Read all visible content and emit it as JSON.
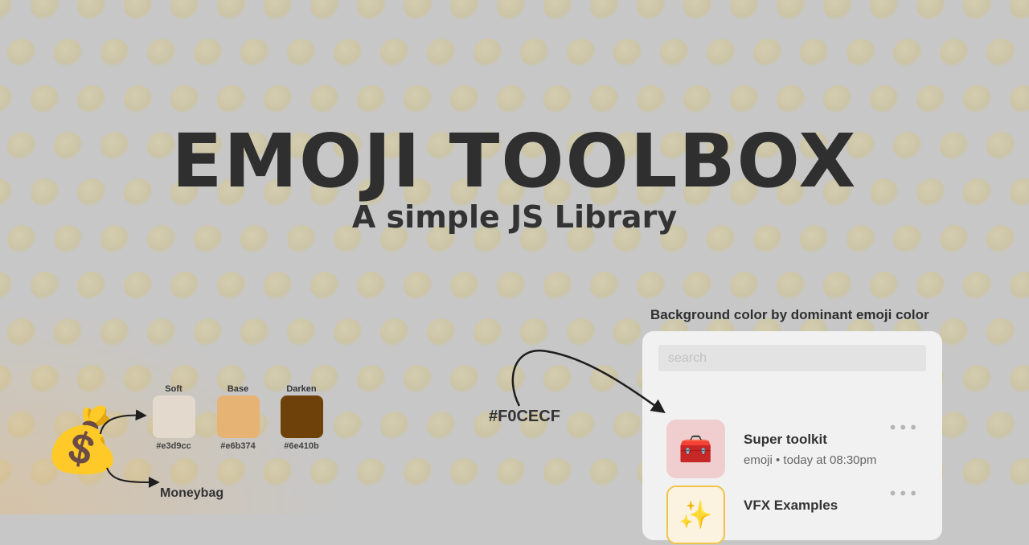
{
  "header": {
    "title": "EMOJI TOOLBOX",
    "subtitle": "A simple JS Library"
  },
  "palette": {
    "emoji": "💰",
    "emoji_icon": "moneybag-icon",
    "name": "Moneybag",
    "swatches": [
      {
        "label": "Soft",
        "hex": "#e3d9cc",
        "color": "#e3d9cc"
      },
      {
        "label": "Base",
        "hex": "#e6b374",
        "color": "#e6b374"
      },
      {
        "label": "Darken",
        "hex": "#6e410b",
        "color": "#6e410b"
      }
    ]
  },
  "callout": {
    "hex": "#F0CECF"
  },
  "card": {
    "caption": "Background color by dominant emoji color",
    "search_placeholder": "search",
    "items": [
      {
        "title": "Super toolkit",
        "meta": "emoji • today at 08:30pm",
        "emoji": "🧰",
        "icon": "toolbox-icon",
        "bg": "#f0cecf",
        "more": "•••"
      },
      {
        "title": "VFX Examples",
        "meta": "",
        "emoji": "✨",
        "icon": "sparkles-icon",
        "bg": "#fbf3df",
        "border": "#f0c44a",
        "more": "•••"
      }
    ]
  },
  "colors": {
    "background": "#c7c7c7",
    "card": "#f1f1f1",
    "text_dark": "#2f2f2f"
  }
}
